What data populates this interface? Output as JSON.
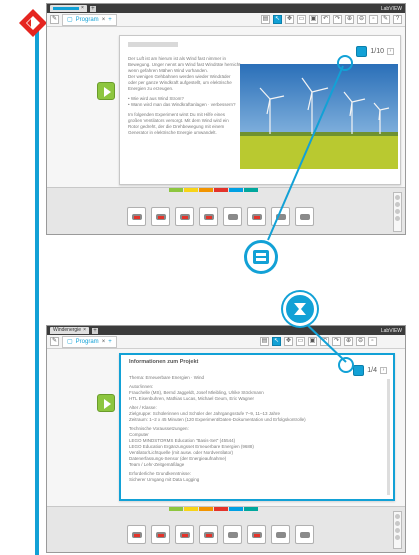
{
  "top": {
    "program_tab": "Program",
    "page_counter": "1/10",
    "lead_text": [
      "Der Luft ist am hierum ist als Wind fast nimmer in",
      "Bewegung. Unger nennt am Wind fast Windräte hernicht,",
      "wenn gefahren Mähen Wind vorhanden.",
      "Der wenigen Gehbahnen werden wieder Windräder",
      "oder per ganze Windkraft aufgestellt, um elektrische",
      "Energien zu erzeugen.",
      "• Wie wird aus Wind Strom?",
      "• Wann wird man das Windkraftanlagen · verbessern?",
      "Im folgenden Experiment wirst Du mit Hilfe eines",
      "großen Ventilators versorgt. Mit dem Wind wird ein",
      "Rotor gedreht, der die Drehbewegung mit einem",
      "Generator in elektrische Energie umwandelt."
    ]
  },
  "bottom": {
    "program_tab": "Program",
    "page_counter": "1/4",
    "panel_title": "Informationen zum Projekt",
    "body_text": [
      "Thema: Erneuerbare Energien · Wind",
      "Autor/innen:",
      "Frauchelle (MS), Bernd Jaggeldt, Josef Mleibling, Ulrike Stöckmann",
      "HTL Eisenbuhren, Mathias Lucas, Michael Geum, Eric Wagner",
      "Alter / Klasse:",
      "Zielgruppe: Schülerinnen und Schüler der Jahrgangsstufe 7–9, 11–13 Jahre",
      "Zeitraum: 1–2 x 45 Minuten (120 Experiment/Daten-Dokumentation und Erfolgskontrolle)",
      "Technische Voraussetzungen:",
      "Computer",
      "LEGO MINDSTORMS Education \"Basis-Set\" (45544)",
      "LEGO Education Ergänzungsset Erneuerbare Energien (9688)",
      "Ventilator/Lichtquelle (mit ausw. oder Nordventilator)",
      "Datenerfassungs-Sensor (der Energieaufnahme)",
      "Team / Lehr-Zeitgemäßlage",
      "Erforderliche Grundkenntnisse:",
      "Sicherer Umgang mit Data Logging"
    ]
  },
  "window": {
    "app_label": "LabVIEW",
    "title_short": "Windenergie"
  },
  "colors": {
    "accent": "#12a1d6",
    "start_green": "#8dc63f",
    "alert_red": "#e4332a"
  },
  "palette_tabs": [
    "#8dc63f",
    "#f7d417",
    "#f29400",
    "#e4332a",
    "#00a0e3",
    "#00a79d"
  ],
  "icons": [
    "back-diamond-icon",
    "content-editor-icon",
    "page-numbering-icon"
  ]
}
